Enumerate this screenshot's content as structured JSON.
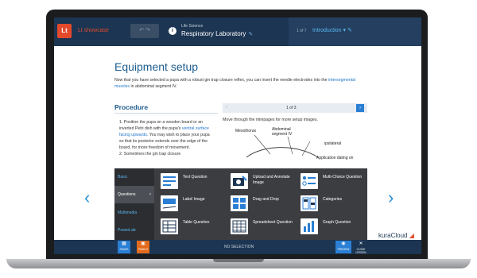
{
  "topbar": {
    "logo": "Lt",
    "app_name": "Lt showcase",
    "crumb_top": "Life Science",
    "crumb_title": "Respiratory Laboratory",
    "section_count": "1 of 7",
    "section_title": "Introduction"
  },
  "content": {
    "title": "Equipment setup",
    "intro_text": "Now that you have selected a pupa with a robust gin trap closure reflex, you can insert the needle electrodes into the",
    "intro_link": "intersegmental muscles",
    "intro_tail": " in abdominal segment IV.",
    "procedure_heading": "Procedure",
    "steps_a": "1. Position the pupa on a wooden board or an inverted Petri dish with the pupa's ",
    "steps_link": "ventral surface facing upwards",
    "steps_b": ". You may wish to place your pupa so that its posterior extends over the edge of the board, for more freedom of movement.",
    "steps_c": "2. Sometimes the gin trap closure",
    "pager_count": "1 of 3",
    "pager_caption": "Move through the minipages for more setup images.",
    "diagram_labels": {
      "mesothorax": "Mesothorax",
      "abdominal_segment": "Abdominal segment IV",
      "ipsilateral": "ipsilateral",
      "application": "Application dating on"
    },
    "brand": "kuraCloud"
  },
  "palette": {
    "categories": [
      {
        "label": "Basic"
      },
      {
        "label": "Questions"
      },
      {
        "label": "Multimedia"
      },
      {
        "label": "PowerLab"
      }
    ],
    "tiles": [
      {
        "label": "Text Question",
        "icon": "text-question-icon"
      },
      {
        "label": "Upload and Annotate Image",
        "icon": "camera-pencil-icon"
      },
      {
        "label": "Multi-Choice Question",
        "icon": "multi-choice-icon"
      },
      {
        "label": "Label Image",
        "icon": "label-image-icon"
      },
      {
        "label": "Drag and Drop",
        "icon": "drag-drop-icon"
      },
      {
        "label": "Categories",
        "icon": "categories-icon"
      },
      {
        "label": "Table Question",
        "icon": "table-question-icon"
      },
      {
        "label": "Spreadsheet Question",
        "icon": "spreadsheet-icon"
      },
      {
        "label": "Graph Question",
        "icon": "graph-question-icon"
      }
    ]
  },
  "bottombar": {
    "pages_label": "PAGES",
    "panels_label": "PANELS",
    "status": "NO SELECTION",
    "preview_label": "PREVIEW",
    "close_label": "CLOSE LESSON"
  },
  "colors": {
    "navy": "#1c3552",
    "accent_orange": "#e34a2c",
    "accent_blue": "#2a7fd4",
    "palette_bg": "#3b3d41"
  }
}
